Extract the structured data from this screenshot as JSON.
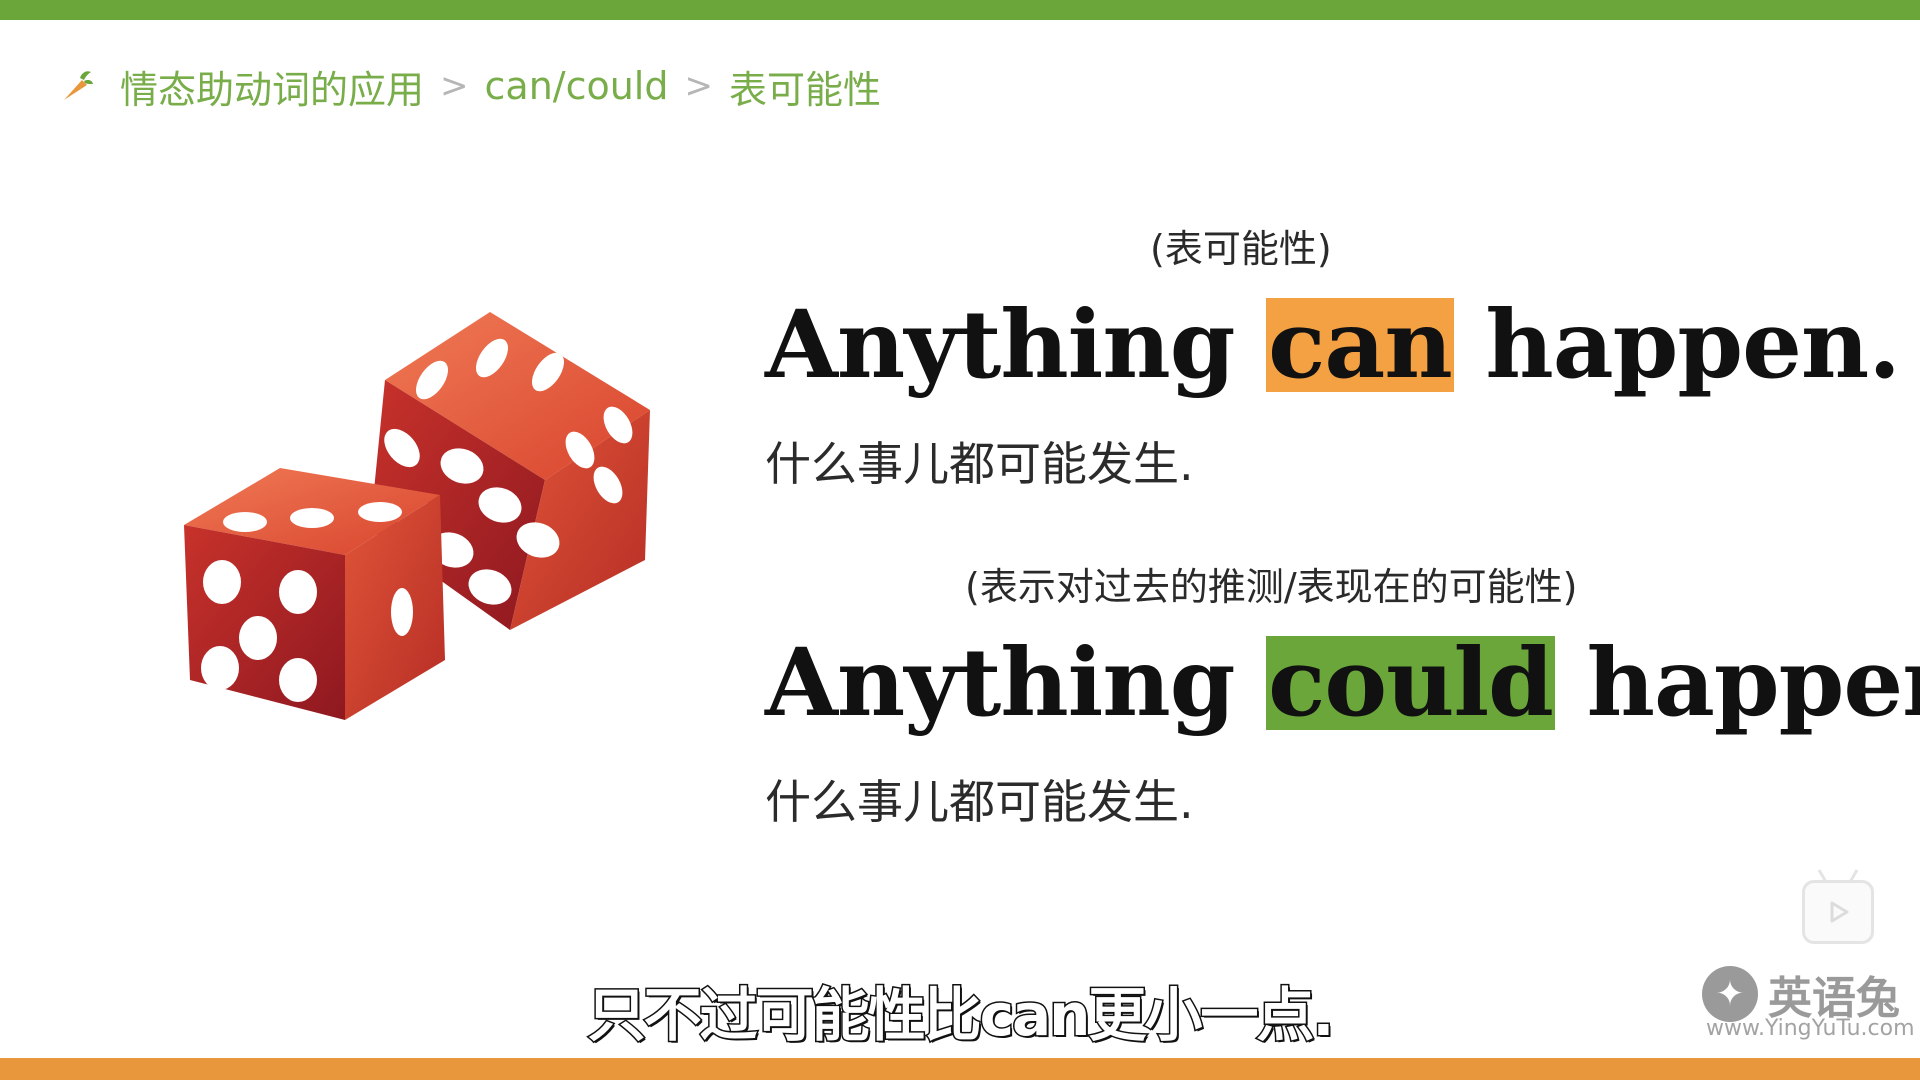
{
  "colors": {
    "accent_green": "#6aa63a",
    "accent_orange": "#f4a144",
    "breadcrumb_text": "#78ad4a"
  },
  "breadcrumb": {
    "icon": "carrot-icon",
    "items": [
      "情态助动词的应用",
      "can/could",
      "表可能性"
    ],
    "separator": ">"
  },
  "sentences": [
    {
      "annotation": "(表可能性)",
      "before": "Anything",
      "highlight": "can",
      "after": "happen.",
      "translation": "什么事儿都可能发生."
    },
    {
      "annotation": "(表示对过去的推测/表现在的可能性)",
      "before": "Anything",
      "highlight": "could",
      "after": "happen.",
      "translation": "什么事儿都可能发生."
    }
  ],
  "subtitle": "只不过可能性比can更小一点.",
  "watermark": {
    "brand": "英语兔",
    "url": "www.YingYuTu.com"
  },
  "icons": {
    "play": "play-icon",
    "dice": "dice-illustration"
  }
}
